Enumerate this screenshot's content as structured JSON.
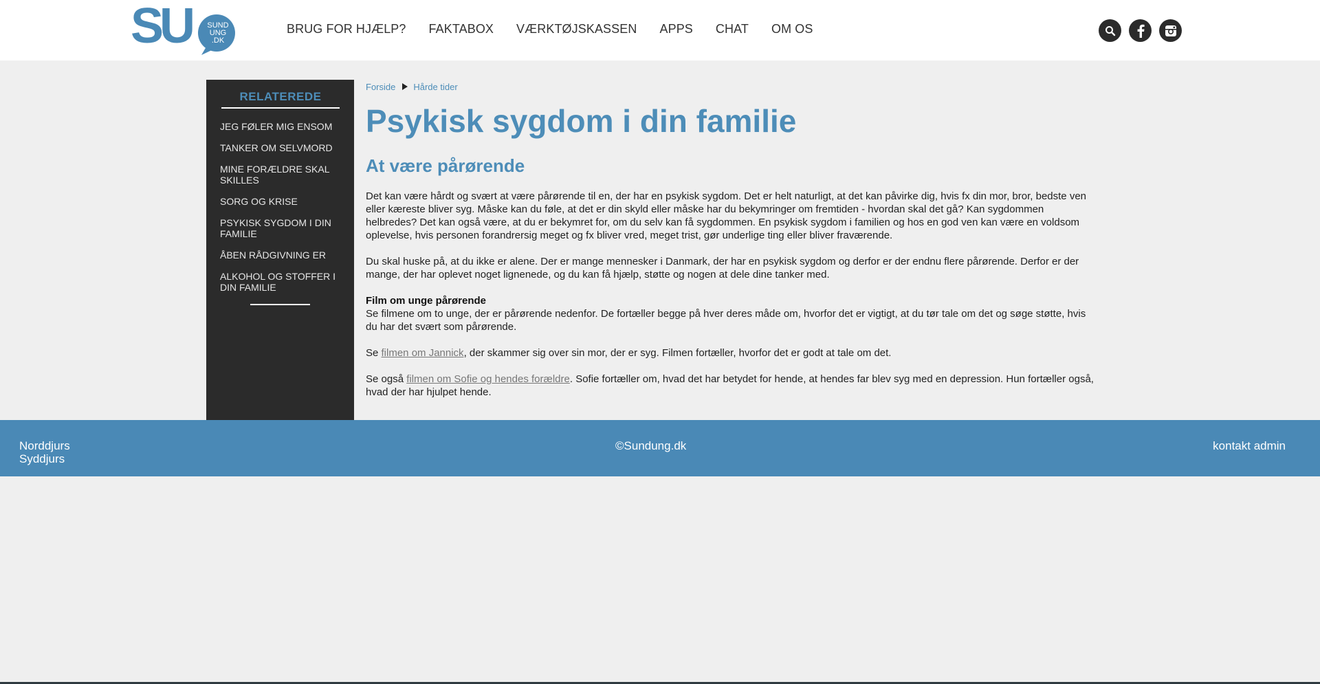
{
  "header": {
    "logo_text": "SU",
    "logo_small_lines": [
      "SUND",
      "UNG",
      ".DK"
    ],
    "nav": [
      {
        "label": "BRUG FOR HJÆLP?"
      },
      {
        "label": "FAKTABOX"
      },
      {
        "label": "VÆRKTØJSKASSEN"
      },
      {
        "label": "APPS"
      },
      {
        "label": "CHAT"
      },
      {
        "label": "OM OS"
      }
    ],
    "social_icons": [
      "search-icon",
      "facebook-icon",
      "instagram-icon"
    ]
  },
  "sidebar": {
    "heading": "RELATEREDE",
    "items": [
      {
        "label": "JEG FØLER MIG ENSOM"
      },
      {
        "label": "TANKER OM SELVMORD"
      },
      {
        "label": "MINE FORÆLDRE SKAL SKILLES"
      },
      {
        "label": "SORG OG KRISE"
      },
      {
        "label": "PSYKISK SYGDOM I DIN FAMILIE"
      },
      {
        "label": "ÅBEN RÅDGIVNING ER"
      },
      {
        "label": "ALKOHOL OG STOFFER I DIN FAMILIE"
      }
    ]
  },
  "breadcrumb": {
    "home": "Forside",
    "current": "Hårde tider"
  },
  "article": {
    "title": "Psykisk sygdom i din familie",
    "subtitle": "At være pårørende",
    "p1": "Det kan være hårdt og svært at være pårørende til en, der har en psykisk sygdom. Det er helt naturligt, at det kan påvirke dig, hvis fx din mor, bror, bedste ven eller kæreste bliver syg. Måske kan du føle, at det er din skyld eller måske har du bekymringer om fremtiden - hvordan skal det gå? Kan sygdommen helbredes? Det kan også være, at du er bekymret for, om du selv kan få sygdommen. En psykisk sygdom i familien og hos en god ven kan være en voldsom oplevelse, hvis personen forandrersig meget og fx bliver vred, meget trist, gør underlige ting eller bliver fraværende.",
    "p2": "Du skal huske på, at du ikke er alene. Der er mange mennesker i Danmark, der har en psykisk sygdom og derfor er der endnu flere pårørende. Derfor er der mange, der har oplevet noget lignenede, og du kan få hjælp, støtte og nogen at dele dine tanker med.",
    "film_heading": "Film om unge pårørende",
    "p3": "Se filmene om to unge, der er pårørende nedenfor. De fortæller begge på hver deres måde om, hvorfor det er vigtigt, at du tør tale om det og søge støtte, hvis du har det svært som pårørende.",
    "p4_prefix": "Se ",
    "p4_link": "filmen om Jannick",
    "p4_suffix": ", der skammer sig over sin mor, der er syg. Filmen fortæller, hvorfor det er godt at tale om det.",
    "p5_prefix": "Se også ",
    "p5_link": "filmen om Sofie og hendes forældre",
    "p5_suffix": ". Sofie fortæller om, hvad det har betydet for hende, at hendes far blev syg med en depression. Hun fortæller også, hvad der har hjulpet hende."
  },
  "footer": {
    "region1": "Norddjurs",
    "region2": "Syddjurs",
    "copyright": "©Sundung.dk",
    "contact": "kontakt admin"
  },
  "colors": {
    "accent": "#4d8db8",
    "footer": "#4a89b6",
    "sidebar": "#2b2b2b",
    "background": "#efefef"
  }
}
